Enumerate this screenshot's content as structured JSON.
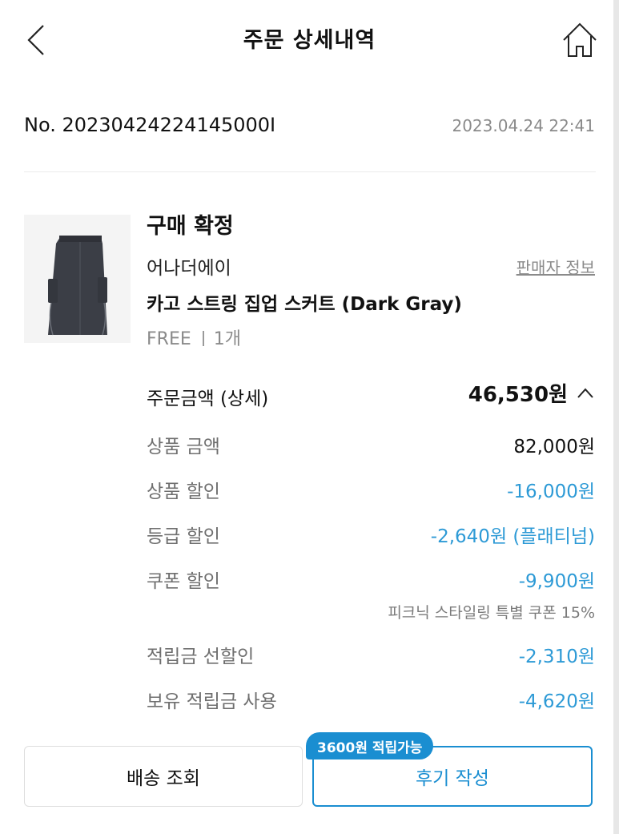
{
  "header": {
    "title": "주문 상세내역",
    "back_icon": "chevron-left-icon",
    "home_icon": "home-icon"
  },
  "order": {
    "number": "No. 20230424224145000I",
    "date": "2023.04.24 22:41"
  },
  "product": {
    "status": "구매 확정",
    "brand": "어나더에이",
    "seller_info_link": "판매자 정보",
    "name": "카고 스트링 집업 스커트 (Dark Gray)",
    "size": "FREE",
    "quantity": "1개"
  },
  "payment": {
    "total_label": "주문금액 (상세)",
    "total_value": "46,530원",
    "expand_icon": "chevron-up-icon",
    "rows": [
      {
        "label": "상품 금액",
        "value": "82,000원"
      },
      {
        "label": "상품 할인",
        "value": "-16,000원"
      },
      {
        "label": "등급 할인",
        "value": "-2,640원 (플래티넘)"
      },
      {
        "label": "쿠폰 할인",
        "value": "-9,900원"
      },
      {
        "label": "적립금 선할인",
        "value": "-2,310원"
      },
      {
        "label": "보유 적립금 사용",
        "value": "-4,620원"
      }
    ],
    "coupon_note": "피크닉 스타일링 특별 쿠폰 15%"
  },
  "actions": {
    "shipping_label": "배송 조회",
    "review_label": "후기 작성",
    "review_badge": "3600원 적립가능"
  },
  "colors": {
    "accent": "#1a8ed1",
    "discount": "#2d9ad6",
    "muted": "#8a8a8a"
  }
}
